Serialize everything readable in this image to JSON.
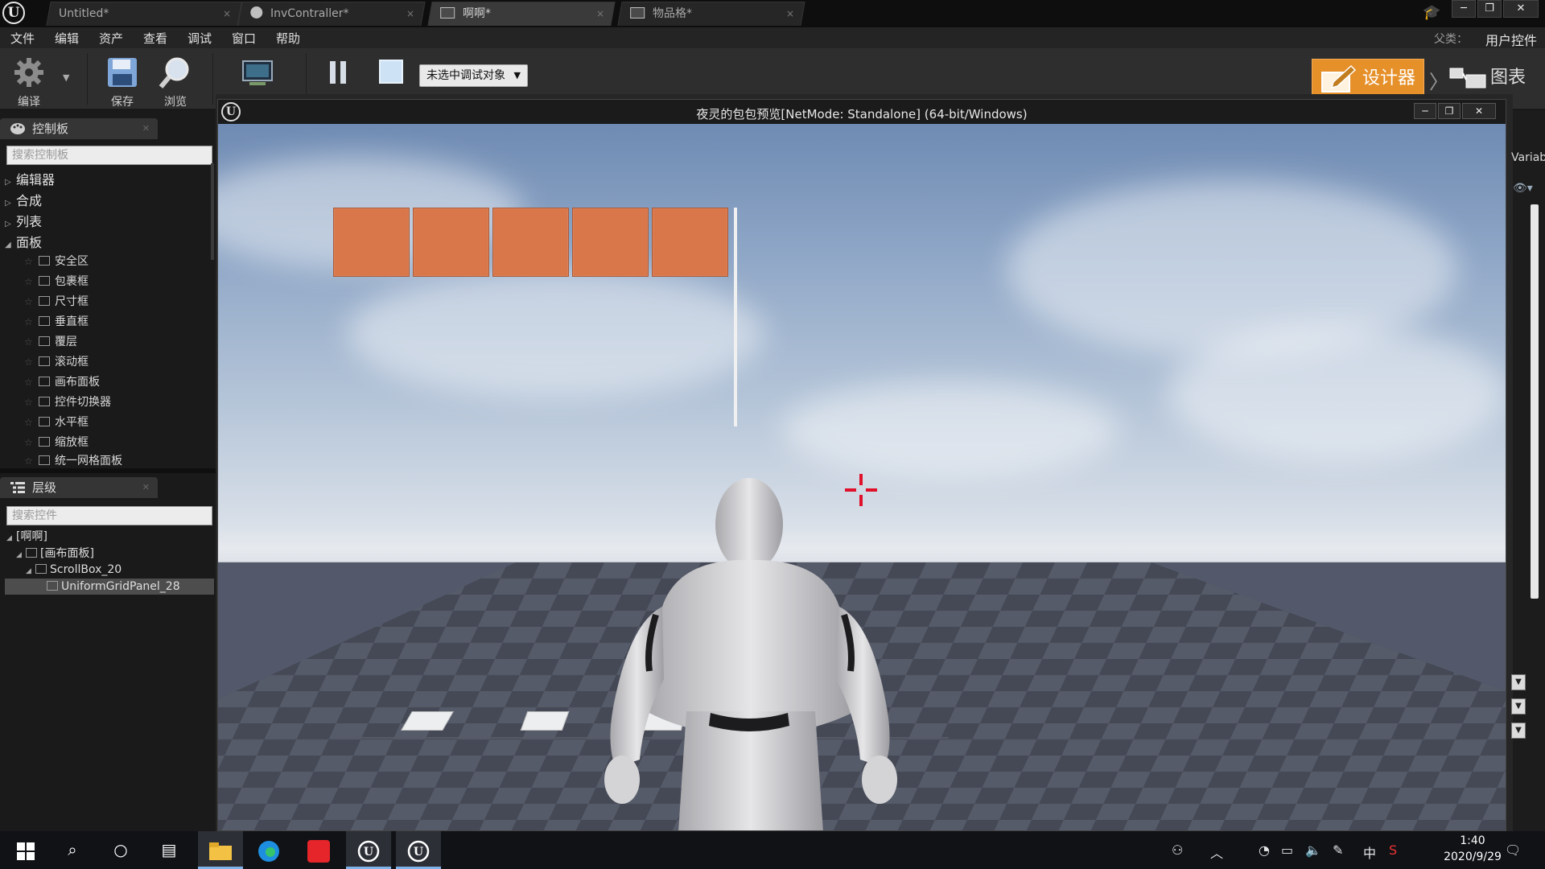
{
  "titlebar": {
    "tabs": [
      {
        "label": "Untitled*"
      },
      {
        "label": "InvContraller*"
      },
      {
        "label": "啊啊*"
      },
      {
        "label": "物品格*"
      }
    ],
    "window_min": "─",
    "window_restore": "❐",
    "window_close": "✕"
  },
  "menubar": {
    "items": [
      "文件",
      "编辑",
      "资产",
      "查看",
      "调试",
      "窗口",
      "帮助"
    ],
    "parent_class_label": "父类：",
    "parent_class_value": "用户控件"
  },
  "toolbar": {
    "compile_label": "编译",
    "save_label": "保存",
    "browse_label": "浏览",
    "debug_object_select": "未选中调试对象",
    "designer_label": "设计器",
    "graph_label": "图表"
  },
  "palette": {
    "title": "控制板",
    "search_placeholder": "搜索控制板",
    "categories": [
      "编辑器",
      "合成",
      "列表",
      "面板"
    ],
    "items": [
      "安全区",
      "包裹框",
      "尺寸框",
      "垂直框",
      "覆层",
      "滚动框",
      "画布面板",
      "控件切换器",
      "水平框",
      "缩放框",
      "统一网格面板"
    ]
  },
  "hierarchy": {
    "title": "层级",
    "search_placeholder": "搜索控件",
    "items": [
      "[啊啊]",
      "[画布面板]",
      "ScrollBox_20",
      "UniformGridPanel_28"
    ]
  },
  "preview": {
    "title": "夜灵的包包预览[NetMode: Standalone] (64-bit/Windows)",
    "slot_count": 5,
    "slot_color": "#d9774a"
  },
  "right_panel": {
    "label": "Variab"
  },
  "taskbar": {
    "time": "1:40",
    "date": "2020/9/29",
    "ime": "中"
  }
}
